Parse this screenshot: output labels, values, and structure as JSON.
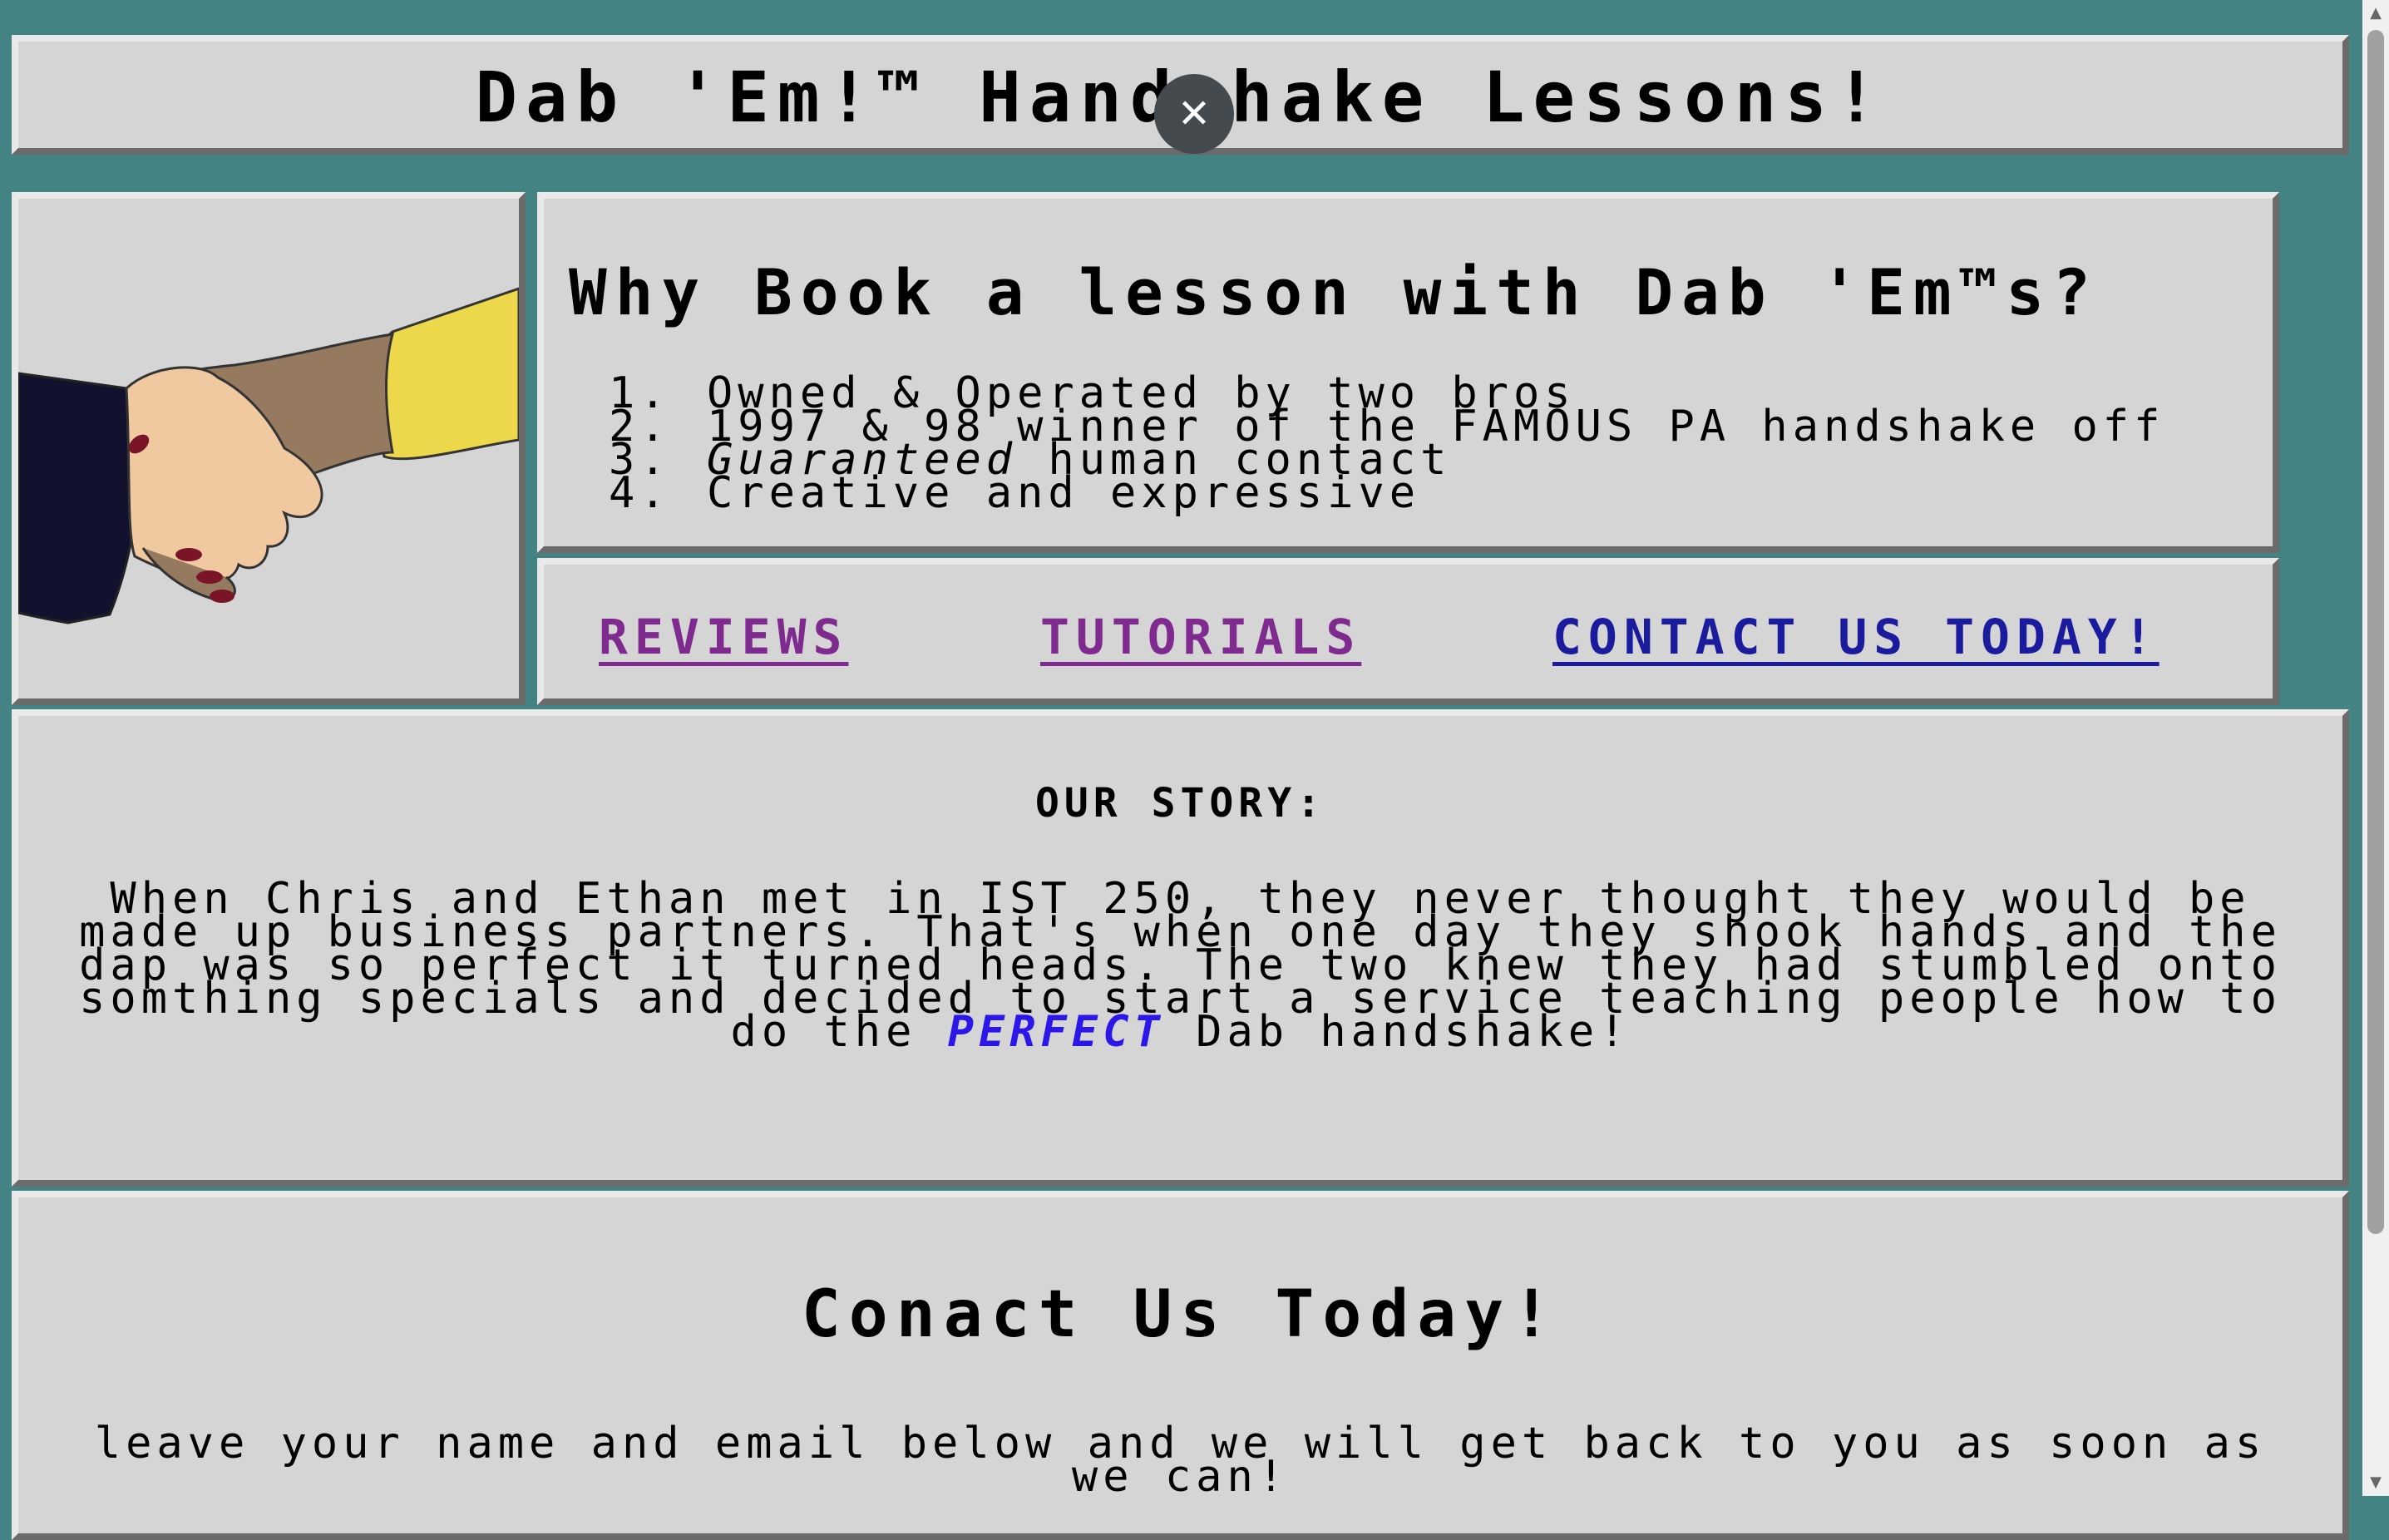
{
  "header": {
    "title": "Dab 'Em!™ Handshake Lessons!"
  },
  "close_icon": "✕",
  "why": {
    "heading": "Why Book a lesson with Dab 'Em™s?",
    "items": [
      {
        "num": "1.",
        "text": "Owned & Operated by two bros"
      },
      {
        "num": "2.",
        "text": "1997 & 98 winner of the FAMOUS PA handshake off"
      },
      {
        "num": "3.",
        "italic": "Guaranteed",
        "text": " human contact"
      },
      {
        "num": "4.",
        "text": "Creative and expressive"
      }
    ]
  },
  "nav": {
    "reviews": "REVIEWS",
    "tutorials": "TUTORIALS",
    "contact": "CONTACT US TODAY!"
  },
  "colors": {
    "background": "#438384",
    "panel": "#d5d5d5",
    "visited_link": "#7e2a8e",
    "link": "#1b1b9e",
    "emphasis": "#2b18e8"
  },
  "story": {
    "heading": "OUR STORY:",
    "text_before": "When Chris and Ethan met in IST 250, they never thought they would be made up business partners. That's when one day they shook hands and the dap was so perfect it turned heads. The two knew they had stumbled onto somthing specials and decided to start a service teaching people how to do the ",
    "emphasis": "PERFECT",
    "text_after": " Dab handshake!"
  },
  "contact": {
    "heading": "Conact Us Today!",
    "subtext": "leave your name and email below and we will get back to you as soon as we can!"
  }
}
